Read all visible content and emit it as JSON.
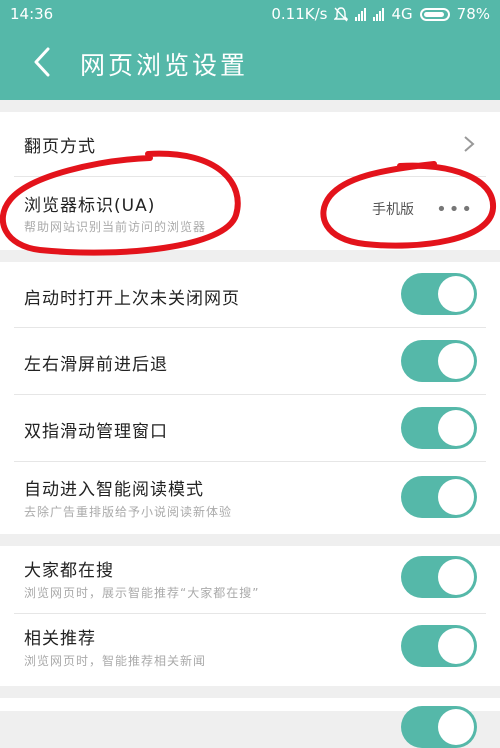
{
  "status_bar": {
    "time": "14:36",
    "speed": "0.11K/s",
    "network": "4G",
    "battery": "78%"
  },
  "header": {
    "title": "网页浏览设置"
  },
  "settings": {
    "page_turn": {
      "label": "翻页方式"
    },
    "ua": {
      "label": "浏览器标识(UA)",
      "desc": "帮助网站识别当前访问的浏览器",
      "value": "手机版",
      "more": "•••"
    },
    "restore_pages": {
      "label": "启动时打开上次未关闭网页",
      "enabled": true
    },
    "swipe_nav": {
      "label": "左右滑屏前进后退",
      "enabled": true
    },
    "two_finger": {
      "label": "双指滑动管理窗口",
      "enabled": true
    },
    "reading_mode": {
      "label": "自动进入智能阅读模式",
      "desc": "去除广告重排版给予小说阅读新体验",
      "enabled": true
    },
    "trending": {
      "label": "大家都在搜",
      "desc": "浏览网页时，展示智能推荐“大家都在搜”",
      "enabled": true
    },
    "related": {
      "label": "相关推荐",
      "desc": "浏览网页时，智能推荐相关新闻",
      "enabled": true
    }
  },
  "colors": {
    "accent": "#55b8a9",
    "annotation": "#e3131b"
  }
}
